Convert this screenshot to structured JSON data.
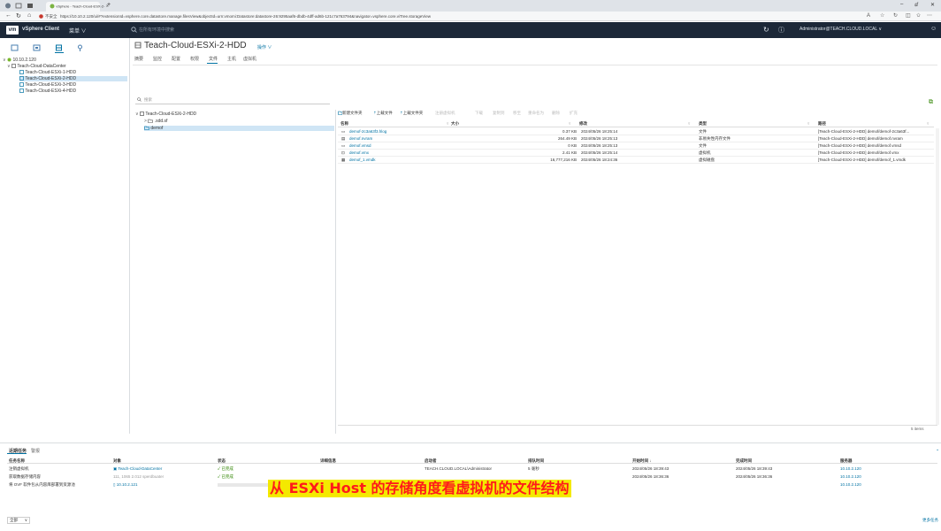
{
  "browser": {
    "tab_title": "vSphere - Teach-Cloud-ESX-2-",
    "tab_close": "×",
    "new_tab": "+",
    "security": "不安全",
    "url": "https://10.10.2.120/ui/#?extensionId=vsphere.core.datastore.manage.filesView&objectId=urn:vmomi:Datastore:datastore-26:9295aaf6-dbdb-4dff-ad6b-121c7a763794&navigator=vsphere.core.viTree.storageView",
    "min": "–",
    "max": "ⅆ",
    "close": "✕"
  },
  "vsphere": {
    "logo": "vm",
    "product": "vSphere Client",
    "menu": "菜单 ∨",
    "search_placeholder": "在所有环境中搜索",
    "user": "Administrator@TEACH.CLOUD.LOCAL ∨"
  },
  "nav": {
    "host": "10.10.2.120",
    "datacenter": "Teach-Cloud-DataCenter",
    "datastores": [
      "Teach-Cloud-ESXi-1-HDD",
      "Teach-Cloud-ESXi-2-HDD",
      "Teach-Cloud-ESXi-3-HDD",
      "Teach-Cloud-ESXi-4-HDD"
    ]
  },
  "page": {
    "title": "Teach-Cloud-ESXi-2-HDD",
    "actions": "操作 ∨",
    "tabs": [
      "摘要",
      "监控",
      "配置",
      "权限",
      "文件",
      "主机",
      "虚拟机"
    ],
    "search": "搜索"
  },
  "folders": {
    "root": "Teach-Cloud-ESXi-2-HDD",
    "items": [
      ".sdd.sf",
      "demof"
    ]
  },
  "toolbar": [
    "新建文件夹",
    "上载文件",
    "上载文件夹",
    "注册虚拟机",
    "下载",
    "复制到",
    "移至",
    "重命名为",
    "删除",
    "扩充"
  ],
  "files": {
    "columns": [
      "名称",
      "大小",
      "修改",
      "类型",
      "路径"
    ],
    "rows": [
      {
        "name": "demof-2c3a63f3.hlog",
        "size": "0.37 KB",
        "mod": "2024/05/26 18:25:14",
        "type": "文件",
        "path": "[Teach-Cloud-ESXi-2-HDD] demof/demof-2c3a63f..."
      },
      {
        "name": "demof.nvram",
        "size": "264.49 KB",
        "mod": "2024/05/26 18:25:13",
        "type": "非易失性内存文件",
        "path": "[Teach-Cloud-ESXi-2-HDD] demof/demof.nvram"
      },
      {
        "name": "demof.vmsd",
        "size": "0 KB",
        "mod": "2024/05/26 18:25:13",
        "type": "文件",
        "path": "[Teach-Cloud-ESXi-2-HDD] demof/demof.vmsd"
      },
      {
        "name": "demof.vmx",
        "size": "2.41 KB",
        "mod": "2024/05/26 18:25:14",
        "type": "虚拟机",
        "path": "[Teach-Cloud-ESXi-2-HDD] demof/demof.vmx"
      },
      {
        "name": "demof_1.vmdk",
        "size": "16,777,216 KB",
        "mod": "2024/05/26 18:24:36",
        "type": "虚拟磁盘",
        "path": "[Teach-Cloud-ESXi-2-HDD] demof/demof_1.vmdk"
      }
    ],
    "count": "5 items"
  },
  "tasks": {
    "tabs": [
      "近期任务",
      "警报"
    ],
    "columns": [
      "任务名称",
      "对象",
      "状态",
      "详细信息",
      "启动者",
      "排队时间",
      "开始时间 ↓",
      "完成时间",
      "服务器"
    ],
    "rows": [
      {
        "name": "注销虚拟机",
        "obj": "Teach-Cloud-DataCenter",
        "status": "已完成",
        "details": "",
        "init": "TEACH.CLOUD.LOCAL\\Administrator",
        "queue": "5 毫秒",
        "start": "2024/05/26 18:39:43",
        "end": "2024/05/26 18:39:43",
        "server": "10.10.2.120"
      },
      {
        "name": "获取数据存储内容",
        "obj": "111, 1065 2.012 sperdbuater",
        "status": "已完成",
        "details": "",
        "init": "",
        "queue": "",
        "start": "2024/05/26 18:36:36",
        "end": "2024/05/26 18:36:36",
        "server": "10.10.2.120"
      },
      {
        "name": "将 OVF 软件包从内容库部署到资源池",
        "obj": "10.10.2.121",
        "status": "",
        "details": "",
        "init": "",
        "queue": "",
        "start": "",
        "end": "",
        "server": "10.10.2.120"
      }
    ],
    "filter": "全部",
    "more": "更多任务"
  },
  "caption": "从 ESXi Host 的存储角度看虚拟机的文件结构",
  "colors": {
    "header": "#1c2838",
    "link": "#0072a3",
    "ok": "#2f8400",
    "caption_bg": "#f4e900",
    "caption_fg": "#ff1a1a"
  }
}
